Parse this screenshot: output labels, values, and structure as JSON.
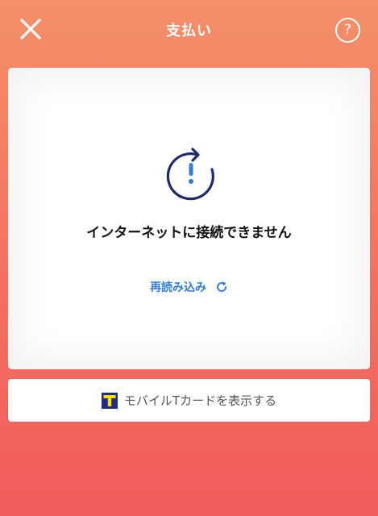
{
  "header": {
    "title": "支払い",
    "close_icon": "close-icon",
    "help_label": "?"
  },
  "error": {
    "icon": "reload-alert-icon",
    "message": "インターネットに接続できません",
    "reload_label": "再読み込み",
    "reload_icon": "reload-icon",
    "accent_color": "#1f2a6b",
    "link_color": "#2f7de1"
  },
  "tcard": {
    "label": "モバイルTカードを表示する",
    "icon": "t-card-logo"
  }
}
